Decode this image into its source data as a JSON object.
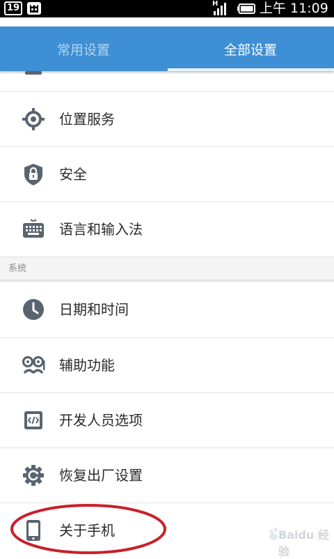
{
  "status_bar": {
    "notification_day": "19",
    "network": "H",
    "clock": "上午 11:09"
  },
  "tabs": [
    {
      "label": "常用设置",
      "selected": false
    },
    {
      "label": "全部设置",
      "selected": true
    }
  ],
  "settings": {
    "items_top": [
      {
        "label": "位置服务",
        "icon": "location-icon"
      },
      {
        "label": "安全",
        "icon": "shield-lock-icon"
      },
      {
        "label": "语言和输入法",
        "icon": "keyboard-icon"
      }
    ],
    "section_system": "系统",
    "items_system": [
      {
        "label": "日期和时间",
        "icon": "clock-icon"
      },
      {
        "label": "辅助功能",
        "icon": "accessibility-icon"
      },
      {
        "label": "开发人员选项",
        "icon": "developer-code-icon"
      },
      {
        "label": "恢复出厂设置",
        "icon": "reset-gear-icon"
      },
      {
        "label": "关于手机",
        "icon": "phone-icon"
      }
    ]
  },
  "colors": {
    "tab_bar": "#3f8fd4",
    "icon_gray": "#5a6470",
    "annotation_oval": "#c8202a"
  },
  "watermark": "Baidu 经验"
}
